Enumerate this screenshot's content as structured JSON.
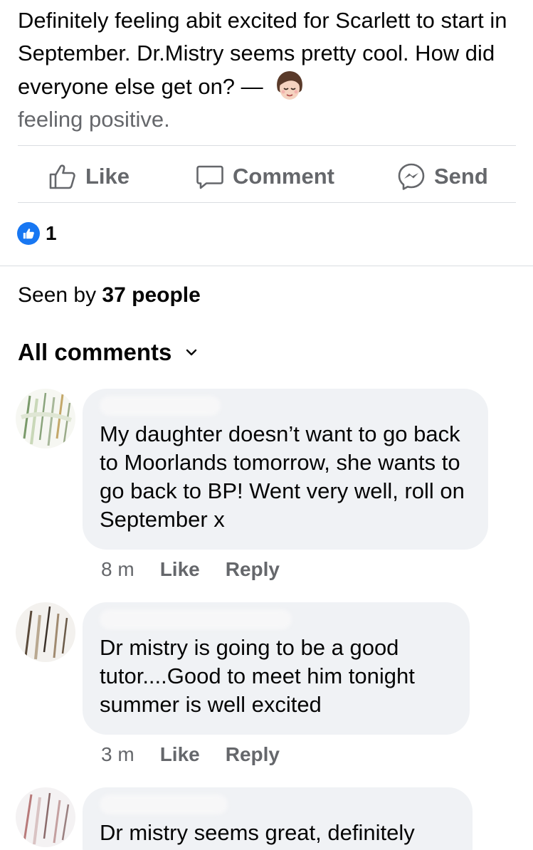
{
  "post": {
    "text": "Definitely feeling abit excited for Scarlett to start in September. Dr.Mistry seems pretty cool. How did everyone else get on? —",
    "feeling": "feeling positive."
  },
  "actions": {
    "like_label": "Like",
    "comment_label": "Comment",
    "send_label": "Send"
  },
  "reactions": {
    "count": "1"
  },
  "seen": {
    "prefix": "Seen by ",
    "count_text": "37 people"
  },
  "comments_header": {
    "label": "All comments"
  },
  "comments": [
    {
      "text": "My daughter doesn’t want to go back to Moorlands tomorrow, she wants to go back to BP! Went very well, roll on September x",
      "time": "8 m",
      "like_label": "Like",
      "reply_label": "Reply"
    },
    {
      "text": "Dr mistry  is going to be a good tutor....Good to meet him tonight summer is well excited",
      "time": "3 m",
      "like_label": "Like",
      "reply_label": "Reply"
    },
    {
      "text": "Dr mistry seems great, definitely"
    }
  ],
  "colors": {
    "text": "#050505",
    "secondary": "#65676b",
    "like_blue": "#1877f2",
    "bubble": "#f0f2f5"
  }
}
